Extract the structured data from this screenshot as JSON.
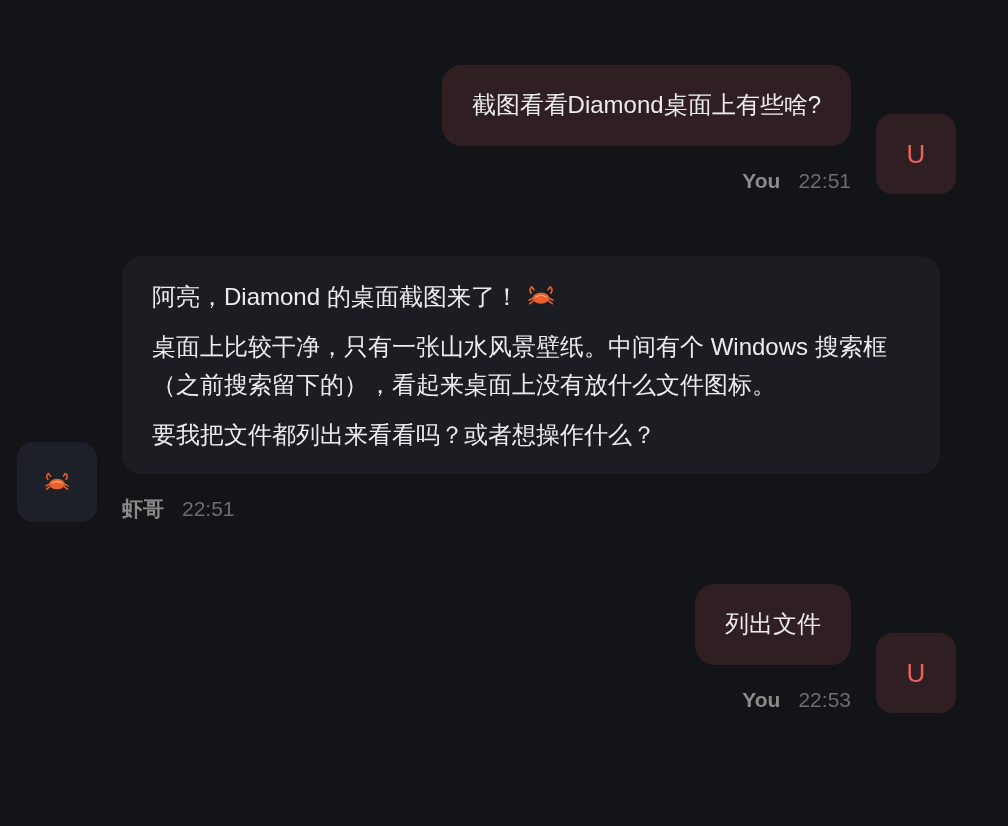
{
  "messages": [
    {
      "kind": "user",
      "paragraphs": [
        {
          "text": "截图看看Diamond桌面上有些啥?"
        }
      ],
      "sender": "You",
      "time": "22:51",
      "avatar": "U"
    },
    {
      "kind": "assistant",
      "paragraphs": [
        {
          "text": "阿亮，Diamond 的桌面截图来了！"
        },
        {
          "text": "桌面上比较干净，只有一张山水风景壁纸。中间有个 Windows 搜索框（之前搜索留下的），看起来桌面上没有放什么文件图标。"
        },
        {
          "text": "要我把文件都列出来看看吗？或者想操作什么？"
        }
      ],
      "sender": "虾哥",
      "time": "22:51"
    },
    {
      "kind": "user",
      "paragraphs": [
        {
          "text": "列出文件"
        }
      ],
      "sender": "You",
      "time": "22:53",
      "avatar": "U"
    }
  ]
}
